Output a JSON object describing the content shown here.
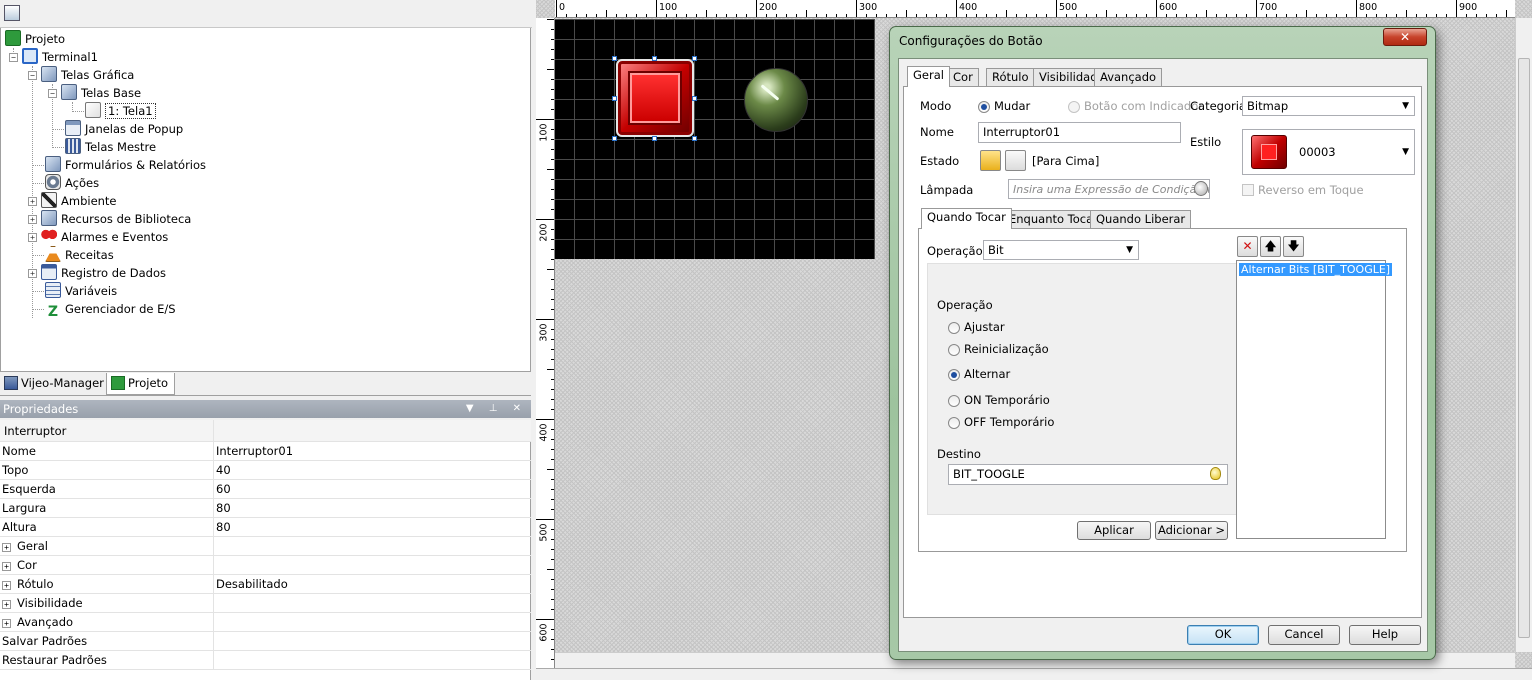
{
  "tree": {
    "root": "Projeto",
    "terminal": "Terminal1",
    "telas_grafica": "Telas Gráfica",
    "telas_base": "Telas Base",
    "tela1": "1: Tela1",
    "janelas_popup": "Janelas de Popup",
    "telas_mestre": "Telas Mestre",
    "formularios": "Formulários & Relatórios",
    "acoes": "Ações",
    "ambiente": "Ambiente",
    "recursos": "Recursos de Biblioteca",
    "alarmes": "Alarmes e Eventos",
    "receitas": "Receitas",
    "registro": "Registro de Dados",
    "variaveis": "Variáveis",
    "gerenciador": "Gerenciador de E/S"
  },
  "tree_tabs": {
    "manager": "Vijeo-Manager",
    "projeto": "Projeto"
  },
  "properties": {
    "header": "Propriedades",
    "object_type": "Interruptor",
    "rows": [
      {
        "name": "Nome",
        "value": "Interruptor01"
      },
      {
        "name": "Topo",
        "value": "40"
      },
      {
        "name": "Esquerda",
        "value": "60"
      },
      {
        "name": "Largura",
        "value": "80"
      },
      {
        "name": "Altura",
        "value": "80"
      },
      {
        "name": "Geral",
        "value": ""
      },
      {
        "name": "Cor",
        "value": ""
      },
      {
        "name": "Rótulo",
        "value": "Desabilitado"
      },
      {
        "name": "Visibilidade",
        "value": ""
      },
      {
        "name": "Avançado",
        "value": ""
      },
      {
        "name": "Salvar Padrões",
        "value": ""
      },
      {
        "name": "Restaurar Padrões",
        "value": ""
      }
    ]
  },
  "rulers": {
    "h": [
      "0",
      "100",
      "200",
      "300",
      "400",
      "500",
      "600",
      "700",
      "800",
      "900"
    ],
    "v": [
      "100",
      "200",
      "300",
      "400",
      "500",
      "600"
    ]
  },
  "dialog": {
    "title": "Configurações do Botão",
    "close_label": "✕",
    "tabs": [
      "Geral",
      "Cor",
      "Rótulo",
      "Visibilidade",
      "Avançado"
    ],
    "modo_label": "Modo",
    "modo_mudar": "Mudar",
    "modo_indicador": "Botão com Indicador",
    "categoria_label": "Categoria",
    "categoria_value": "Bitmap",
    "nome_label": "Nome",
    "nome_value": "Interruptor01",
    "estilo_label": "Estilo",
    "estilo_value": "00003",
    "estado_label": "Estado",
    "estado_value": "[Para Cima]",
    "lampada_label": "Lâmpada",
    "lampada_placeholder": "Insira uma Expressão de Condição válida",
    "reverso_label": "Reverso em Toque",
    "event_tabs": [
      "Quando Tocar",
      "Enquanto Tocar",
      "Quando Liberar"
    ],
    "operacao_label": "Operação",
    "operacao_value": "Bit",
    "operacao_group_label": "Operação",
    "ops": [
      "Ajustar",
      "Reinicialização",
      "Alternar",
      "ON Temporário",
      "OFF Temporário"
    ],
    "selected_op": "Alternar",
    "destino_label": "Destino",
    "destino_value": "BIT_TOOGLE",
    "actions_list": [
      "Alternar Bits [BIT_TOOGLE]"
    ],
    "aplicar": "Aplicar",
    "adicionar": "Adicionar >",
    "ok": "OK",
    "cancel": "Cancel",
    "help": "Help"
  },
  "colors": {
    "accent_selection": "#3399ff",
    "dialog_frame": "#a7c8a7",
    "button_red": "#cc0000"
  }
}
